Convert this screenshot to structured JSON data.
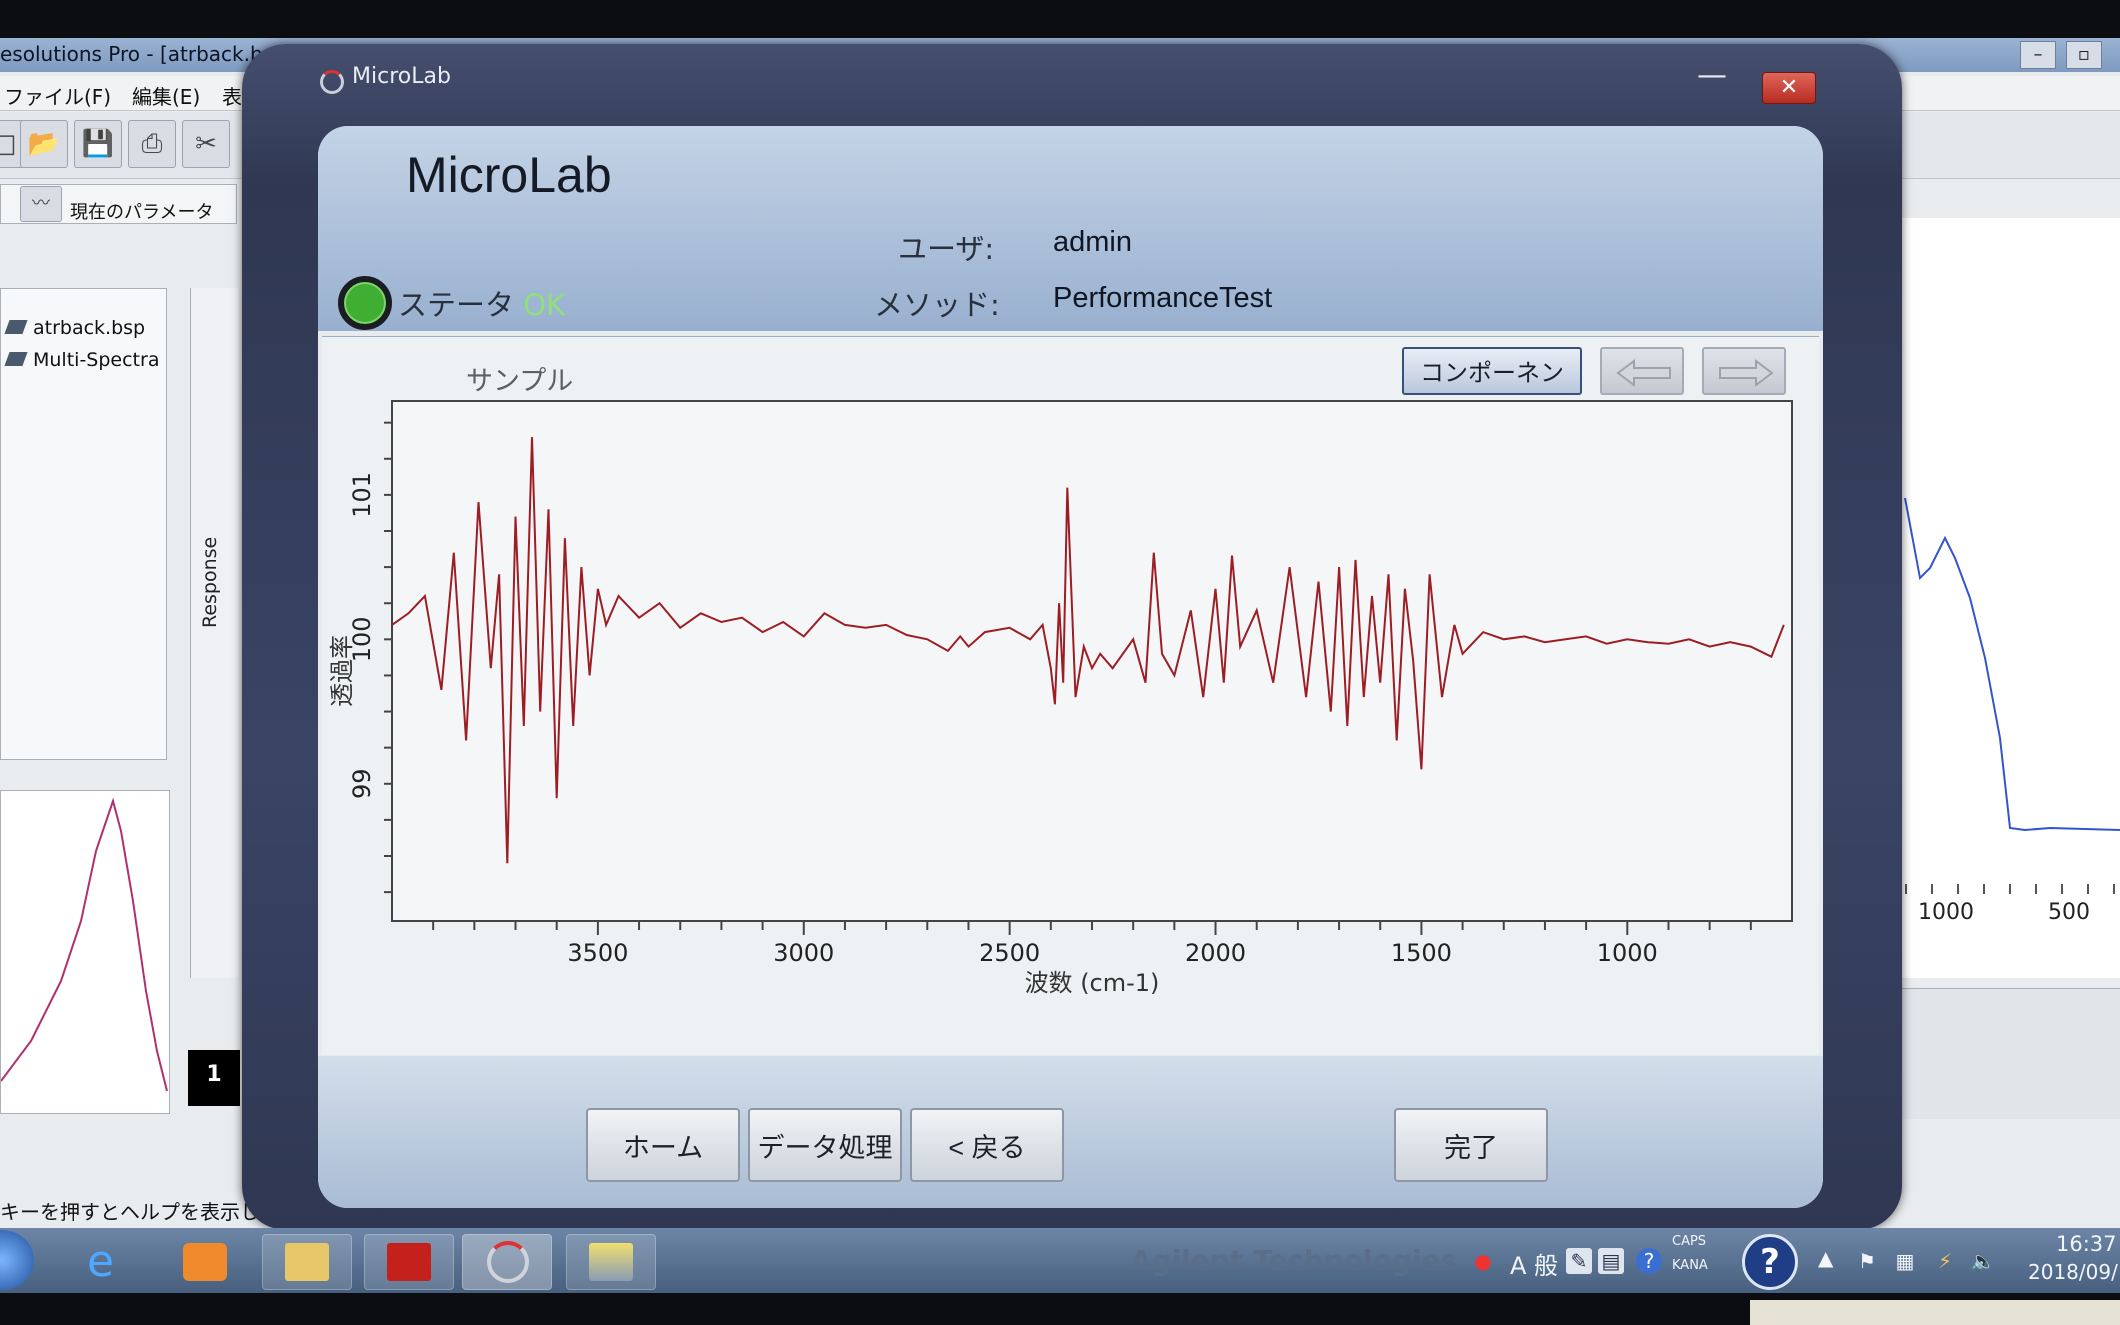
{
  "background_app": {
    "title": "esolutions Pro - [atrback.bsp",
    "menu": [
      "ファイル(F)",
      "編集(E)",
      "表"
    ],
    "param_label": "現在のパラメータ",
    "tree_items": [
      "atrback.bsp",
      "Multi-Spectra"
    ],
    "response_label": "Response",
    "plot_ticks": [
      "1000",
      "500"
    ],
    "badge": "1",
    "status_text": "キーを押すとヘルプを表示し"
  },
  "dialog": {
    "window_title": "MicroLab",
    "close_symbol": "✕",
    "minimize_symbol": "—",
    "app_name": "MicroLab",
    "user_label": "ユーザ:",
    "user_value": "admin",
    "method_label": "メソッド:",
    "method_value": "PerformanceTest",
    "status_label": "ステータ",
    "status_value": "OK",
    "status_color": "#3fae33",
    "sample_label": "サンプル",
    "component_button": "コンポーネント",
    "nav_prev_icon": "arrow-left-icon",
    "nav_next_icon": "arrow-right-icon",
    "footer": {
      "home": "ホーム",
      "data_processing": "データ処理",
      "back": "< 戻る",
      "finish": "完了"
    }
  },
  "chart_data": {
    "type": "line",
    "title": "",
    "xlabel": "波数 (cm-1)",
    "ylabel": "透過率",
    "xlim": [
      4000,
      600
    ],
    "ylim": [
      98.05,
      101.65
    ],
    "x_ticks": [
      3500,
      3000,
      2500,
      2000,
      1500,
      1000
    ],
    "y_ticks": [
      99,
      100,
      101
    ],
    "grid": false,
    "line_color": "#9c1e24",
    "series": [
      {
        "x": [
          4000,
          3960,
          3920,
          3880,
          3850,
          3820,
          3790,
          3760,
          3740,
          3720,
          3700,
          3680,
          3660,
          3640,
          3620,
          3600,
          3580,
          3560,
          3540,
          3520,
          3500,
          3480,
          3450,
          3400,
          3350,
          3300,
          3250,
          3200,
          3150,
          3100,
          3050,
          3000,
          2950,
          2900,
          2850,
          2800,
          2750,
          2700,
          2650,
          2620,
          2600,
          2560,
          2500,
          2450,
          2420,
          2400,
          2390,
          2380,
          2370,
          2360,
          2340,
          2320,
          2300,
          2280,
          2250,
          2200,
          2170,
          2150,
          2130,
          2100,
          2060,
          2030,
          2000,
          1980,
          1960,
          1940,
          1900,
          1860,
          1820,
          1780,
          1750,
          1720,
          1700,
          1680,
          1660,
          1640,
          1620,
          1600,
          1580,
          1560,
          1540,
          1520,
          1500,
          1480,
          1450,
          1420,
          1400,
          1350,
          1300,
          1250,
          1200,
          1150,
          1100,
          1050,
          1000,
          950,
          900,
          850,
          800,
          750,
          700,
          650,
          620
        ],
        "values": [
          100.1,
          100.18,
          100.3,
          99.65,
          100.6,
          99.3,
          100.95,
          99.8,
          100.45,
          98.45,
          100.85,
          99.4,
          101.4,
          99.5,
          100.9,
          98.9,
          100.7,
          99.4,
          100.5,
          99.75,
          100.35,
          100.1,
          100.3,
          100.15,
          100.25,
          100.08,
          100.18,
          100.12,
          100.15,
          100.05,
          100.12,
          100.02,
          100.18,
          100.1,
          100.08,
          100.1,
          100.03,
          100.0,
          99.92,
          100.02,
          99.95,
          100.05,
          100.08,
          100.0,
          100.1,
          99.8,
          99.55,
          100.25,
          99.7,
          101.05,
          99.6,
          99.95,
          99.8,
          99.9,
          99.8,
          100.0,
          99.7,
          100.6,
          99.9,
          99.75,
          100.2,
          99.6,
          100.35,
          99.7,
          100.58,
          99.95,
          100.2,
          99.7,
          100.5,
          99.6,
          100.4,
          99.5,
          100.5,
          99.4,
          100.55,
          99.6,
          100.3,
          99.7,
          100.45,
          99.3,
          100.35,
          99.85,
          99.1,
          100.45,
          99.6,
          100.1,
          99.9,
          100.05,
          100.0,
          100.02,
          99.98,
          100.0,
          100.02,
          99.97,
          100.0,
          99.98,
          99.97,
          100.0,
          99.95,
          99.98,
          99.95,
          99.88,
          100.1
        ]
      }
    ]
  },
  "taskbar": {
    "clock_time": "16:37",
    "clock_date": "2018/09/",
    "caps_text": "CAPS",
    "kana_text": "KANA",
    "ime_mode": "A 般",
    "brand_watermark": "Agilent Technologies"
  }
}
